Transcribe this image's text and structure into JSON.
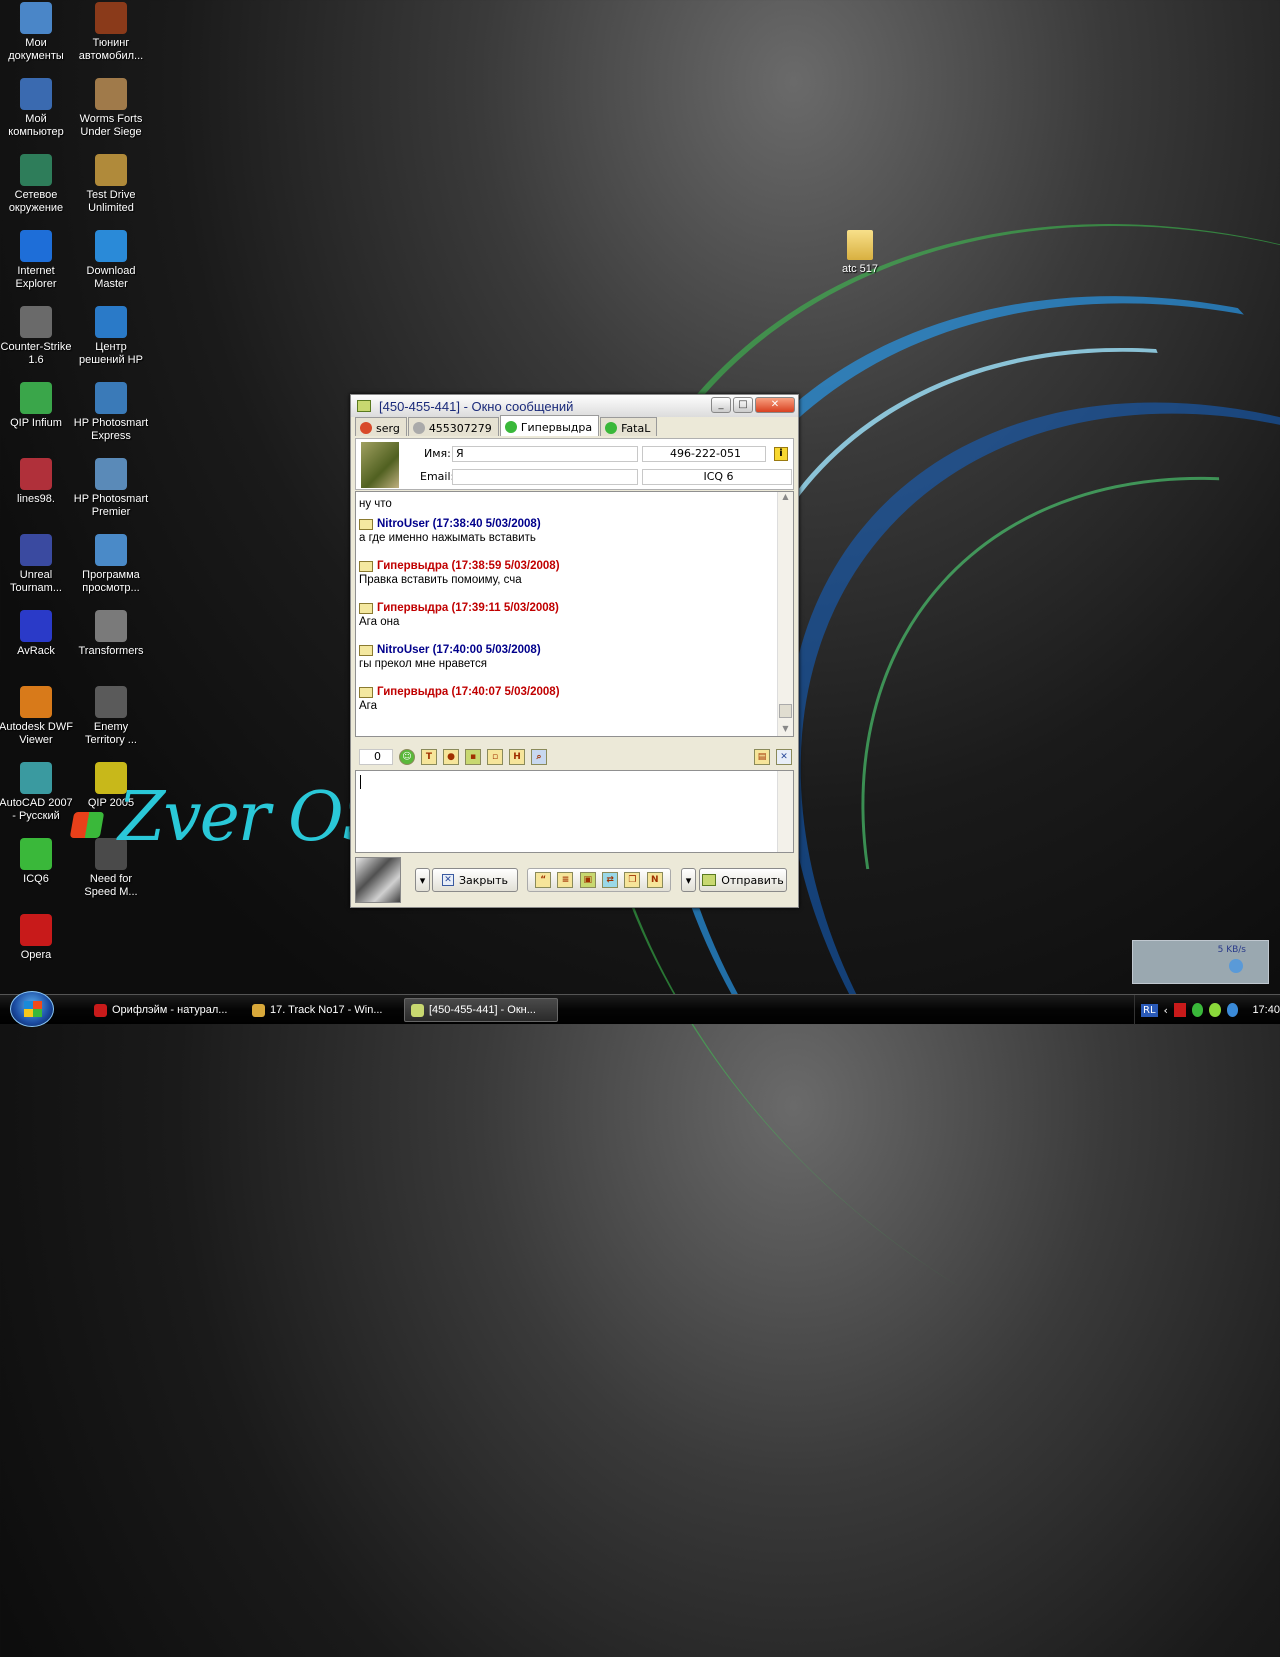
{
  "desktop": {
    "col1": [
      {
        "label": "Мои документы",
        "icon": "documents-icon",
        "color": "#4a86c8"
      },
      {
        "label": "Мой компьютер",
        "icon": "computer-icon",
        "color": "#3a6ab0"
      },
      {
        "label": "Сетевое окружение",
        "icon": "network-icon",
        "color": "#2e7d5a"
      },
      {
        "label": "Internet Explorer",
        "icon": "ie-icon",
        "color": "#1e6ed8"
      },
      {
        "label": "Counter-Strike 1.6",
        "icon": "counter-strike-icon",
        "color": "#6a6a6a"
      },
      {
        "label": "QIP Infium",
        "icon": "qip-infium-icon",
        "color": "#3aa64a"
      },
      {
        "label": "lines98.",
        "icon": "lines98-icon",
        "color": "#b0303a"
      },
      {
        "label": "Unreal Tournam...",
        "icon": "unreal-icon",
        "color": "#3a4aa0"
      },
      {
        "label": "AvRack",
        "icon": "avrack-icon",
        "color": "#2a3ac8"
      },
      {
        "label": "Autodesk DWF Viewer",
        "icon": "dwf-viewer-icon",
        "color": "#d87a1a"
      },
      {
        "label": "AutoCAD 2007 - Русский",
        "icon": "autocad-icon",
        "color": "#3a9aa0"
      },
      {
        "label": "ICQ6",
        "icon": "icq-icon",
        "color": "#3ab83a"
      },
      {
        "label": "Opera",
        "icon": "opera-icon",
        "color": "#c81a1a"
      }
    ],
    "col2": [
      {
        "label": "Тюнинг автомобил...",
        "icon": "tuning-icon",
        "color": "#8a3a1a"
      },
      {
        "label": "Worms Forts Under Siege",
        "icon": "worms-icon",
        "color": "#a07a4a"
      },
      {
        "label": "Test Drive Unlimited",
        "icon": "test-drive-icon",
        "color": "#b08a3a"
      },
      {
        "label": "Download Master",
        "icon": "download-master-icon",
        "color": "#2a8ad8"
      },
      {
        "label": "Центр решений HP",
        "icon": "hp-center-icon",
        "color": "#2a7ac8"
      },
      {
        "label": "HP Photosmart Express",
        "icon": "hp-photosmart-express-icon",
        "color": "#3a7ab8"
      },
      {
        "label": "HP Photosmart Premier",
        "icon": "hp-photosmart-premier-icon",
        "color": "#5a8ab8"
      },
      {
        "label": "Программа просмотр...",
        "icon": "viewer-program-icon",
        "color": "#4a8ac8"
      },
      {
        "label": "Transformers",
        "icon": "transformers-icon",
        "color": "#7a7a7a"
      },
      {
        "label": "Enemy Territory ...",
        "icon": "enemy-territory-icon",
        "color": "#5a5a5a"
      },
      {
        "label": "QIP 2005",
        "icon": "qip-2005-icon",
        "color": "#c8b81a"
      },
      {
        "label": "Need for Speed M...",
        "icon": "nfs-icon",
        "color": "#4a4a4a"
      }
    ],
    "folder": {
      "label": "atc 517",
      "icon": "folder-icon"
    },
    "watermark": "Zver OS"
  },
  "window": {
    "title": "[450-455-441] - Окно сообщений",
    "tabs": [
      {
        "label": "serg",
        "color": "#d84a2a"
      },
      {
        "label": "455307279",
        "color": "#aaaaaa"
      },
      {
        "label": "Гипервыдра",
        "color": "#3ab83a"
      },
      {
        "label": "FataL",
        "color": "#3ab83a"
      }
    ],
    "name_label": "Имя:",
    "name_value": "Я",
    "uin_value": "496-222-051",
    "email_label": "Email:",
    "email_value": "",
    "client_value": "ICQ 6",
    "messages": [
      {
        "header": "",
        "text": "ну что",
        "color": "#c00000"
      },
      {
        "header": "NitroUser (17:38:40 5/03/2008)",
        "text": "а где именно нажымать вставить",
        "color": "#00008b"
      },
      {
        "header": "Гипервыдра (17:38:59 5/03/2008)",
        "text": "Правка вставить помоиму, сча",
        "color": "#c00000"
      },
      {
        "header": "Гипервыдра (17:39:11 5/03/2008)",
        "text": "Ага она",
        "color": "#c00000"
      },
      {
        "header": "NitroUser (17:40:00 5/03/2008)",
        "text": "гы прекол мне нравется",
        "color": "#00008b"
      },
      {
        "header": "Гипервыдра (17:40:07 5/03/2008)",
        "text": "Ага",
        "color": "#c00000"
      }
    ],
    "char_count": "0",
    "close_label": "Закрыть",
    "send_label": "Отправить"
  },
  "taskbar": {
    "items": [
      {
        "label": "Орифлэйм - натурал...",
        "icon": "opera-icon"
      },
      {
        "label": "17. Track No17 - Win...",
        "icon": "winamp-icon"
      },
      {
        "label": "[450-455-441] - Окн...",
        "icon": "qip-message-icon"
      }
    ],
    "lang": "RL",
    "clock": "17:40",
    "net_speed": "5 KB/s"
  }
}
